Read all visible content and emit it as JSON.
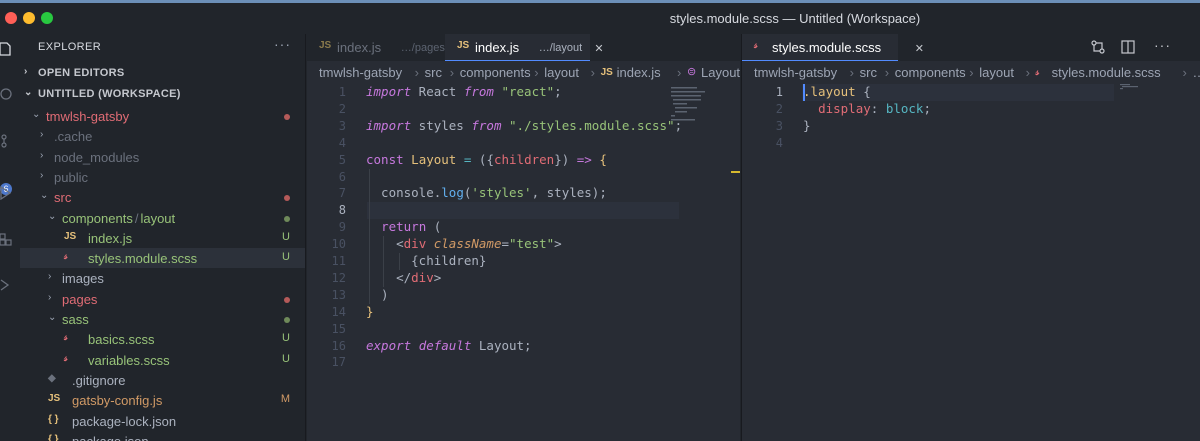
{
  "window": {
    "title": "styles.module.scss — Untitled (Workspace)",
    "lights": [
      "#ff5f57",
      "#febc2e",
      "#28c840"
    ]
  },
  "activity_bar": {
    "badge": "6"
  },
  "explorer": {
    "header": "EXPLORER",
    "more": "···",
    "open_editors": "OPEN EDITORS",
    "workspace": "UNTITLED (WORKSPACE)",
    "tree": [
      {
        "name": "tmwlsh-gatsby",
        "type": "folder",
        "open": true,
        "depth": 0,
        "color": "#e06c75",
        "deco": "dot",
        "deco_color": "#b55a59"
      },
      {
        "name": ".cache",
        "type": "folder",
        "open": false,
        "depth": 1,
        "color": "#6b717d"
      },
      {
        "name": "node_modules",
        "type": "folder",
        "open": false,
        "depth": 1,
        "color": "#6b717d"
      },
      {
        "name": "public",
        "type": "folder",
        "open": false,
        "depth": 1,
        "color": "#6b717d"
      },
      {
        "name": "src",
        "type": "folder",
        "open": true,
        "depth": 1,
        "color": "#e06c75",
        "deco": "dot",
        "deco_color": "#b55a59"
      },
      {
        "name": "components",
        "name2": "layout",
        "type": "folder",
        "open": true,
        "depth": 2,
        "color": "#98c379",
        "deco": "dot",
        "deco_color": "#6f8a5a"
      },
      {
        "name": "index.js",
        "type": "js",
        "depth": 3,
        "color": "#98c379",
        "deco": "U",
        "deco_color": "#98c379"
      },
      {
        "name": "styles.module.scss",
        "type": "scss",
        "depth": 3,
        "color": "#98c379",
        "deco": "U",
        "deco_color": "#98c379",
        "active": true
      },
      {
        "name": "images",
        "type": "folder",
        "open": false,
        "depth": 2,
        "color": "#abb2bf"
      },
      {
        "name": "pages",
        "type": "folder",
        "open": false,
        "depth": 2,
        "color": "#e06c75",
        "deco": "dot",
        "deco_color": "#b55a59"
      },
      {
        "name": "sass",
        "type": "folder",
        "open": true,
        "depth": 2,
        "color": "#98c379",
        "deco": "dot",
        "deco_color": "#6f8a5a"
      },
      {
        "name": "basics.scss",
        "type": "scss",
        "depth": 3,
        "color": "#98c379",
        "deco": "U",
        "deco_color": "#98c379"
      },
      {
        "name": "variables.scss",
        "type": "scss",
        "depth": 3,
        "color": "#98c379",
        "deco": "U",
        "deco_color": "#98c379"
      },
      {
        "name": ".gitignore",
        "type": "git",
        "depth": 1,
        "color": "#abb2bf"
      },
      {
        "name": "gatsby-config.js",
        "type": "js",
        "depth": 1,
        "color": "#d19a66",
        "deco": "M",
        "deco_color": "#d19a66"
      },
      {
        "name": "package-lock.json",
        "type": "json",
        "depth": 1,
        "color": "#abb2bf"
      },
      {
        "name": "package.json",
        "type": "json",
        "depth": 1,
        "color": "#abb2bf"
      }
    ]
  },
  "editor_left": {
    "tabs": [
      {
        "icon": "JS",
        "label": "index.js",
        "desc": "…/pages",
        "active": false
      },
      {
        "icon": "JS",
        "label": "index.js",
        "desc": "…/layout",
        "active": true,
        "close": "✕"
      }
    ],
    "breadcrumbs": [
      "tmwlsh-gatsby",
      "src",
      "components",
      "layout",
      "index.js",
      "Layout"
    ],
    "current_line": 8,
    "lines": [
      [
        [
          "ki",
          "import"
        ],
        [
          "p",
          " React "
        ],
        [
          "ki",
          "from"
        ],
        [
          "p",
          " "
        ],
        [
          "s",
          "\"react\""
        ],
        [
          "p",
          ";"
        ]
      ],
      [],
      [
        [
          "ki",
          "import"
        ],
        [
          "p",
          " styles "
        ],
        [
          "ki",
          "from"
        ],
        [
          "p",
          " "
        ],
        [
          "s",
          "\"./styles.module.scss\""
        ],
        [
          "p",
          ";"
        ]
      ],
      [],
      [
        [
          "k",
          "const"
        ],
        [
          "p",
          " "
        ],
        [
          "v",
          "Layout"
        ],
        [
          "p",
          " "
        ],
        [
          "o",
          "="
        ],
        [
          "p",
          " ({"
        ],
        [
          "r",
          "children"
        ],
        [
          "p",
          "}) "
        ],
        [
          "k",
          "=>"
        ],
        [
          "p",
          " "
        ],
        [
          "y",
          "{"
        ]
      ],
      [],
      [
        [
          "p",
          "  console."
        ],
        [
          "f",
          "log"
        ],
        [
          "p",
          "("
        ],
        [
          "s",
          "'styles'"
        ],
        [
          "p",
          ", styles);"
        ]
      ],
      [],
      [
        [
          "p",
          "  "
        ],
        [
          "k",
          "return"
        ],
        [
          "p",
          " ("
        ]
      ],
      [
        [
          "p",
          "    <"
        ],
        [
          "r",
          "div"
        ],
        [
          "p",
          " "
        ],
        [
          "a",
          "className"
        ],
        [
          "p",
          "="
        ],
        [
          "s",
          "\"test\""
        ],
        [
          "p",
          ">"
        ]
      ],
      [
        [
          "p",
          "      {children}"
        ]
      ],
      [
        [
          "p",
          "    </"
        ],
        [
          "r",
          "div"
        ],
        [
          "p",
          ">"
        ]
      ],
      [
        [
          "p",
          "  )"
        ]
      ],
      [
        [
          "y",
          "}"
        ]
      ],
      [],
      [
        [
          "ki",
          "export"
        ],
        [
          "p",
          " "
        ],
        [
          "ki",
          "default"
        ],
        [
          "p",
          " Layout;"
        ]
      ],
      []
    ]
  },
  "editor_right": {
    "tabs": [
      {
        "icon": "scss",
        "label": "styles.module.scss",
        "active": true,
        "close": "✕"
      }
    ],
    "breadcrumbs": [
      "tmwlsh-gatsby",
      "src",
      "components",
      "layout",
      "styles.module.scss",
      "…"
    ],
    "current_line": 1,
    "lines": [
      [
        [
          "y",
          ".layout"
        ],
        [
          "p",
          " {"
        ]
      ],
      [
        [
          "p",
          "  "
        ],
        [
          "r",
          "display"
        ],
        [
          "p",
          ": "
        ],
        [
          "o",
          "block"
        ],
        [
          "p",
          ";"
        ]
      ],
      [
        [
          "p",
          "}"
        ]
      ],
      []
    ]
  }
}
